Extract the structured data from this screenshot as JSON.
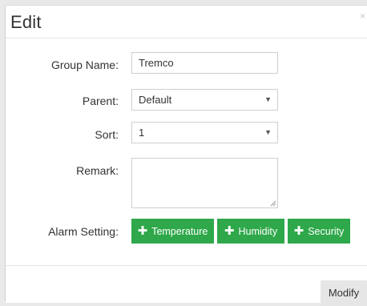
{
  "dialog": {
    "title": "Edit",
    "close_label": "×"
  },
  "form": {
    "group_name_label": "Group Name:",
    "group_name_value": "Tremco",
    "parent_label": "Parent:",
    "parent_value": "Default",
    "sort_label": "Sort:",
    "sort_value": "1",
    "remark_label": "Remark:",
    "remark_value": "",
    "alarm_label": "Alarm Setting:"
  },
  "alarm_buttons": {
    "temperature": "Temperature",
    "humidity": "Humidity",
    "security": "Security",
    "plus": "✚"
  },
  "footer": {
    "modify_label": "Modify"
  },
  "colors": {
    "accent_green": "#2ea84a",
    "modify_bg": "#e6e6e6"
  }
}
